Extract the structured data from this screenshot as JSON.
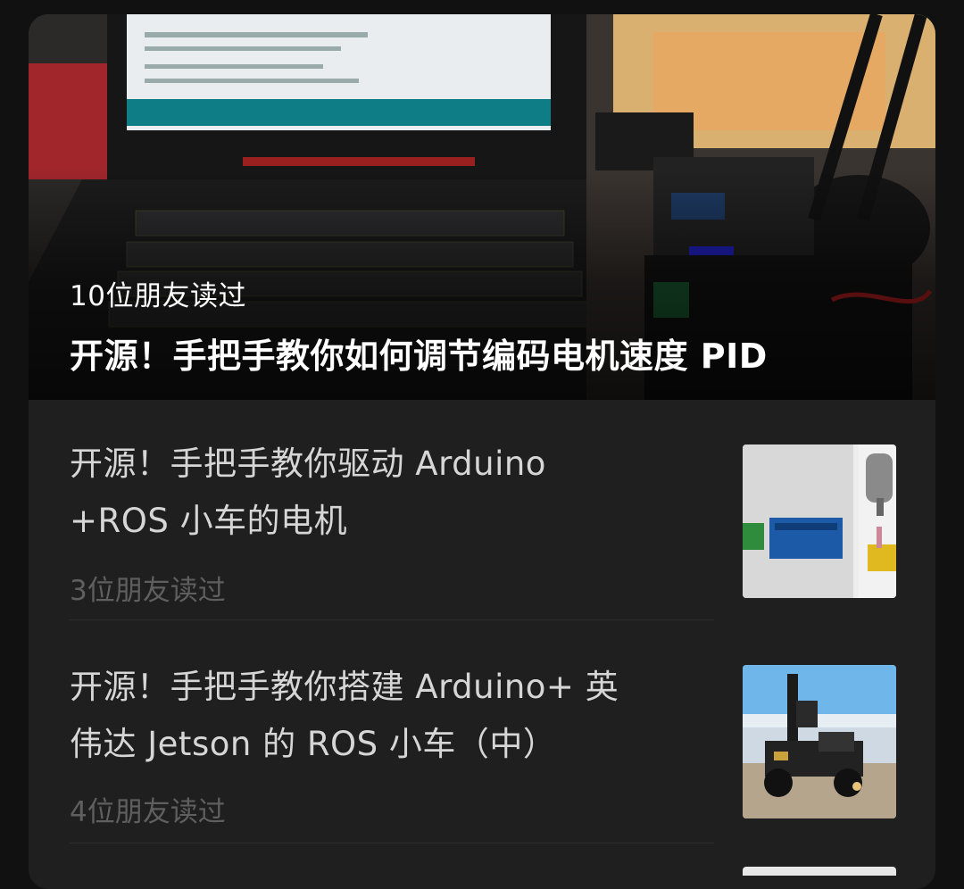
{
  "hero": {
    "readers": "10位朋友读过",
    "title": "开源！手把手教你如何调节编码电机速度 PID"
  },
  "articles": [
    {
      "title_line1": "开源！手把手教你驱动 Arduino",
      "title_line2": "+ROS 小车的电机",
      "readers": "3位朋友读过"
    },
    {
      "title_line1": "开源！手把手教你搭建 Arduino+ 英",
      "title_line2": "伟达 Jetson 的 ROS 小车（中）",
      "readers": "4位朋友读过"
    }
  ]
}
